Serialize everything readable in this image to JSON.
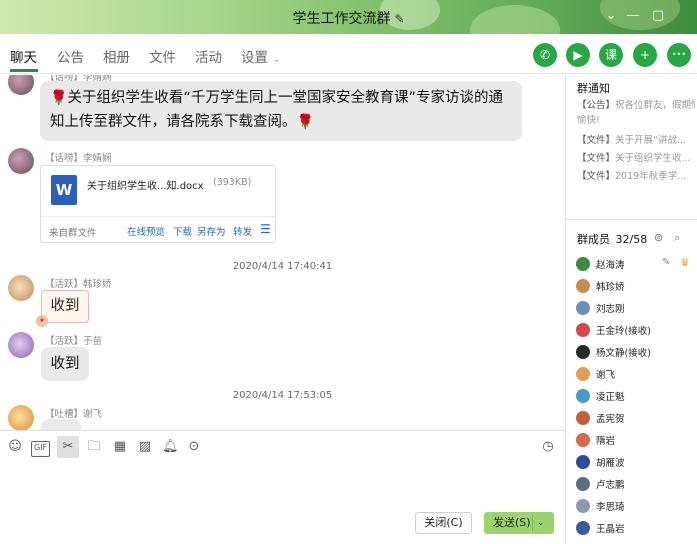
{
  "window": {
    "title": "学生工作交流群",
    "title_edit_icon": "pencil-icon",
    "controls": [
      "collapse-icon",
      "minimize-icon",
      "maximize-icon"
    ]
  },
  "nav": {
    "tabs": [
      {
        "label": "聊天",
        "active": true
      },
      {
        "label": "公告"
      },
      {
        "label": "相册"
      },
      {
        "label": "文件"
      },
      {
        "label": "活动"
      },
      {
        "label": "设置",
        "has_dropdown": true
      }
    ],
    "actions": [
      {
        "icon": "phone-icon",
        "glyph": "✆"
      },
      {
        "icon": "video-icon",
        "glyph": "▶"
      },
      {
        "icon": "classroom-icon",
        "glyph": "课"
      },
      {
        "icon": "add-app-icon",
        "glyph": "+"
      },
      {
        "icon": "more-icon",
        "glyph": "•••"
      }
    ],
    "accent_color": "#2aa745"
  },
  "chat": {
    "top_partial_sender": "【话唠】李婧娴",
    "messages": [
      {
        "type": "text",
        "text": "关于组织学生收看“千万学生同上一堂国家安全教育课”专家访谈的通知上传至群文件，请各院系下载查阅。",
        "emoji": "rose-icon"
      },
      {
        "type": "file",
        "sender": "【话唠】李婧娴",
        "file_name": "关于组织学生收...知.docx",
        "file_size": "(393KB)",
        "source": "来自群文件",
        "actions": [
          "在线预览",
          "下载",
          "另存为",
          "转发"
        ]
      },
      {
        "type": "timestamp",
        "text": "2020/4/14 17:40:41"
      },
      {
        "type": "text",
        "sender": "【活跃】韩珍娇",
        "text": "收到"
      },
      {
        "type": "text",
        "sender": "【活跃】于苗",
        "text": "收到"
      },
      {
        "type": "timestamp",
        "text": "2020/4/14 17:53:05"
      },
      {
        "type": "text",
        "sender": "【吐槽】谢飞",
        "text": ""
      }
    ]
  },
  "toolbar": {
    "tools": [
      "emoji-icon",
      "gif-icon",
      "screenshot-scissors-icon",
      "folder-icon",
      "image-text-icon",
      "image-icon",
      "bell-icon",
      "more-tools-icon"
    ],
    "history_icon": "clock-icon",
    "close_label": "关闭(C)",
    "send_label": "发送(S)",
    "send_color": "#9bd46d"
  },
  "notice": {
    "title": "群通知",
    "items": [
      {
        "tag": "【公告】",
        "text": "祝各位群友，假期愉快!"
      },
      {
        "tag": "【文件】",
        "text": "关于开展“讲战..."
      },
      {
        "tag": "【文件】",
        "text": "关于组织学生收..."
      },
      {
        "tag": "【文件】",
        "text": "2019年秋季学..."
      }
    ]
  },
  "members": {
    "title": "群成员",
    "count": "32/58",
    "list": [
      {
        "name": "赵海涛",
        "color": "#3d8b3d"
      },
      {
        "name": "韩珍娇",
        "color": "#c98a4a"
      },
      {
        "name": "刘志刚",
        "color": "#6b8fb5"
      },
      {
        "name": "王金玲(接收)",
        "color": "#d04a4a"
      },
      {
        "name": "杨文静(接收)",
        "color": "#2a2a2a"
      },
      {
        "name": "谢飞",
        "color": "#e0a050"
      },
      {
        "name": "凌正魁",
        "color": "#4a9ac7"
      },
      {
        "name": "孟宪贺",
        "color": "#c06040"
      },
      {
        "name": "隋岩",
        "color": "#d66a4a"
      },
      {
        "name": "胡雁波",
        "color": "#2a4f9a"
      },
      {
        "name": "卢志鹏",
        "color": "#5a6f80"
      },
      {
        "name": "李思琦",
        "color": "#8a9ab0"
      },
      {
        "name": "王晶岩",
        "color": "#3a5a9a"
      }
    ]
  }
}
